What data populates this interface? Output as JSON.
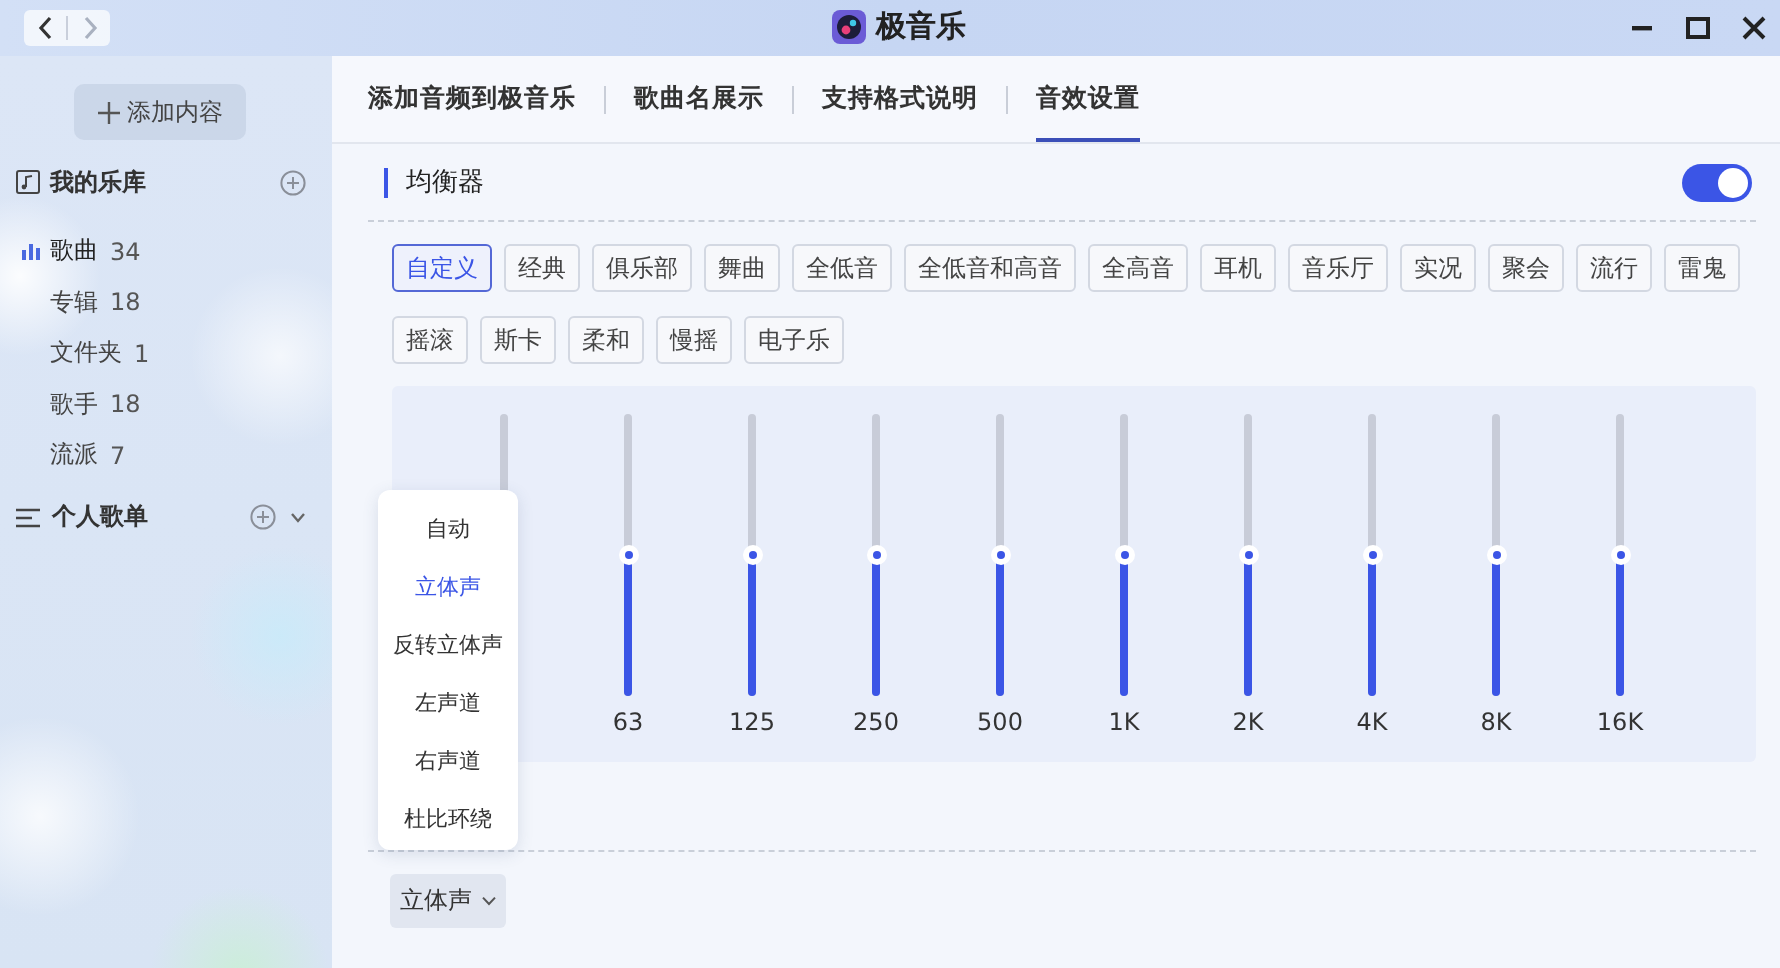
{
  "window": {
    "title": "极音乐",
    "nav": {
      "back_disabled": false,
      "forward_disabled": true
    }
  },
  "sidebar": {
    "add_button": "添加内容",
    "library": {
      "title": "我的乐库",
      "items": [
        {
          "label": "歌曲",
          "count": "34",
          "selected": true
        },
        {
          "label": "专辑",
          "count": "18",
          "selected": false
        },
        {
          "label": "文件夹",
          "count": "1",
          "selected": false
        },
        {
          "label": "歌手",
          "count": "18",
          "selected": false
        },
        {
          "label": "流派",
          "count": "7",
          "selected": false
        }
      ]
    },
    "playlists": {
      "title": "个人歌单"
    }
  },
  "tabs": [
    {
      "label": "添加音频到极音乐",
      "selected": false
    },
    {
      "label": "歌曲名展示",
      "selected": false
    },
    {
      "label": "支持格式说明",
      "selected": false
    },
    {
      "label": "音效设置",
      "selected": true
    }
  ],
  "equalizer": {
    "title": "均衡器",
    "on": true,
    "presets": [
      {
        "label": "自定义",
        "selected": true
      },
      {
        "label": "经典",
        "selected": false
      },
      {
        "label": "俱乐部",
        "selected": false
      },
      {
        "label": "舞曲",
        "selected": false
      },
      {
        "label": "全低音",
        "selected": false
      },
      {
        "label": "全低音和高音",
        "selected": false
      },
      {
        "label": "全高音",
        "selected": false
      },
      {
        "label": "耳机",
        "selected": false
      },
      {
        "label": "音乐厅",
        "selected": false
      },
      {
        "label": "实况",
        "selected": false
      },
      {
        "label": "聚会",
        "selected": false
      },
      {
        "label": "流行",
        "selected": false
      },
      {
        "label": "雷鬼",
        "selected": false
      },
      {
        "label": "摇滚",
        "selected": false
      },
      {
        "label": "斯卡",
        "selected": false
      },
      {
        "label": "柔和",
        "selected": false
      },
      {
        "label": "慢摇",
        "selected": false
      },
      {
        "label": "电子乐",
        "selected": false
      }
    ],
    "bands": [
      {
        "kind": "bare"
      },
      {
        "kind": "slider",
        "label": "63",
        "level": 0.5
      },
      {
        "kind": "slider",
        "label": "125",
        "level": 0.5
      },
      {
        "kind": "slider",
        "label": "250",
        "level": 0.5
      },
      {
        "kind": "slider",
        "label": "500",
        "level": 0.5
      },
      {
        "kind": "slider",
        "label": "1K",
        "level": 0.5
      },
      {
        "kind": "slider",
        "label": "2K",
        "level": 0.5
      },
      {
        "kind": "slider",
        "label": "4K",
        "level": 0.5
      },
      {
        "kind": "slider",
        "label": "8K",
        "level": 0.5
      },
      {
        "kind": "slider",
        "label": "16K",
        "level": 0.5
      }
    ],
    "channel_menu": {
      "items": [
        {
          "label": "自动",
          "selected": false
        },
        {
          "label": "立体声",
          "selected": true
        },
        {
          "label": "反转立体声",
          "selected": false
        },
        {
          "label": "左声道",
          "selected": false
        },
        {
          "label": "右声道",
          "selected": false
        },
        {
          "label": "杜比环绕",
          "selected": false
        }
      ]
    },
    "channel_select": {
      "value": "立体声"
    }
  }
}
